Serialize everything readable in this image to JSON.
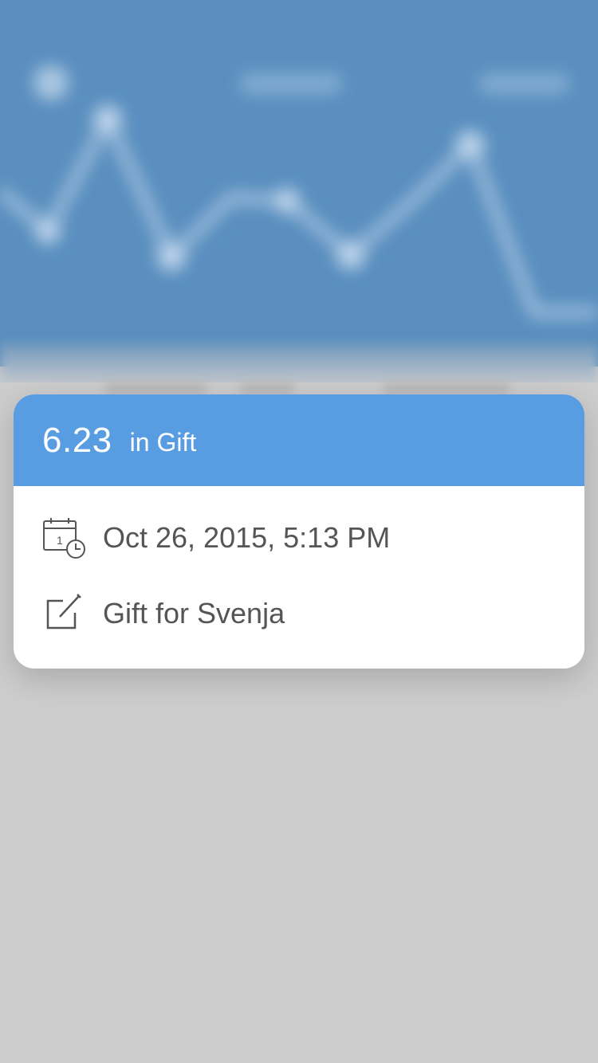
{
  "card": {
    "amount": "6.23",
    "category_text": "in Gift",
    "header_color": "#589de1",
    "date": {
      "icon": "calendar-clock-icon",
      "text": "Oct 26, 2015, 5:13 PM"
    },
    "note": {
      "icon": "edit-note-icon",
      "text": "Gift for Svenja"
    }
  },
  "background": {
    "chart_color": "#5a8fbf",
    "base_color": "#cdcdcd"
  }
}
